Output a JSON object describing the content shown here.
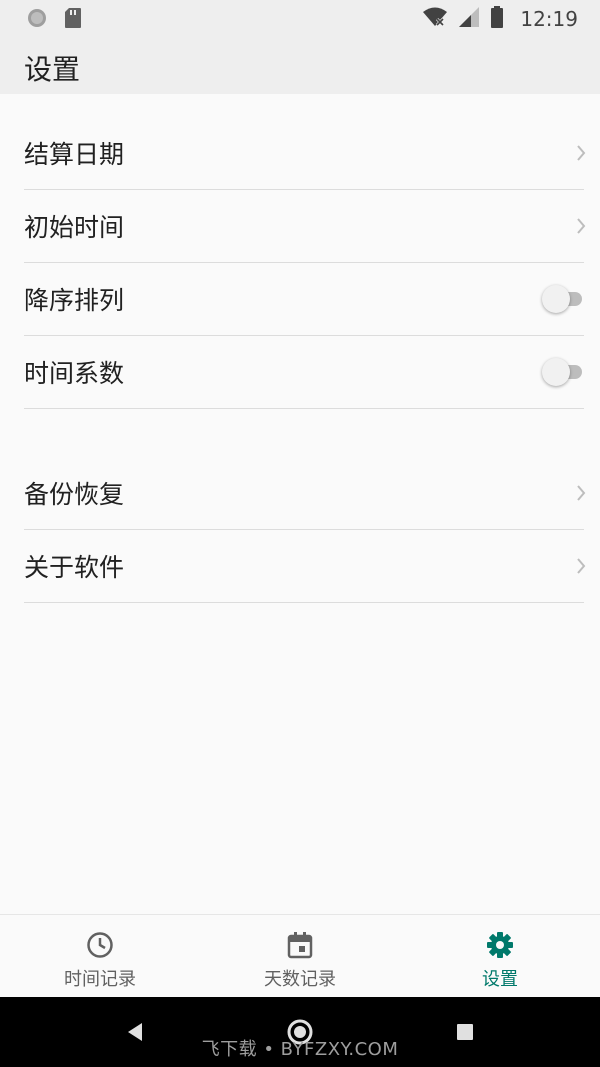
{
  "status_bar": {
    "time": "12:19",
    "icons": [
      "sync-icon",
      "sd-card-icon",
      "wifi-x-icon",
      "signal-icon",
      "battery-icon"
    ]
  },
  "app_bar": {
    "title": "设置"
  },
  "settings": {
    "items": [
      {
        "label": "结算日期",
        "control": "chevron"
      },
      {
        "label": "初始时间",
        "control": "chevron"
      },
      {
        "label": "降序排列",
        "control": "switch",
        "on": false
      },
      {
        "label": "时间系数",
        "control": "switch",
        "on": false
      },
      {
        "label": "备份恢复",
        "control": "chevron"
      },
      {
        "label": "关于软件",
        "control": "chevron"
      }
    ]
  },
  "bottom_nav": {
    "tabs": [
      {
        "label": "时间记录",
        "icon": "clock-icon",
        "active": false
      },
      {
        "label": "天数记录",
        "icon": "calendar-icon",
        "active": false
      },
      {
        "label": "设置",
        "icon": "gear-icon",
        "active": true
      }
    ],
    "active_color": "#00796b"
  },
  "system_nav": {
    "watermark": "飞下载 • BYFZXY.COM"
  }
}
